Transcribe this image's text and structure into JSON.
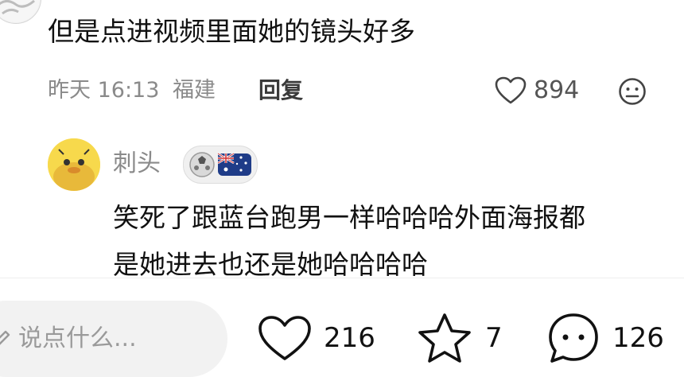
{
  "comment1": {
    "text": "但是点进视频里面她的镜头好多",
    "time": "昨天 16:13",
    "location": "福建",
    "reply_label": "回复",
    "likes": "894"
  },
  "comment2": {
    "username": "刺头",
    "text_line1": "笑死了跟蓝台跑男一样哈哈哈外面海报都",
    "text_line2": "是她进去也还是她哈哈哈哈"
  },
  "bottom_bar": {
    "input_placeholder": "说点什么...",
    "like_count": "216",
    "favorite_count": "7",
    "comment_count": "126"
  },
  "colors": {
    "text_primary": "#111111",
    "text_secondary": "#8a8a8a",
    "input_bg": "#f2f2f2"
  }
}
